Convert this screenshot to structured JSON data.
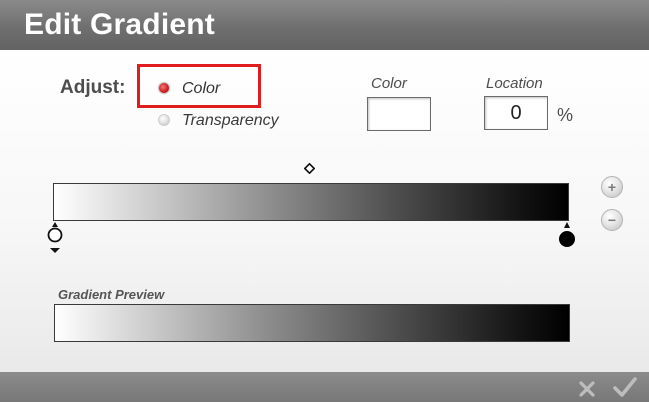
{
  "dialog": {
    "title": "Edit Gradient"
  },
  "adjust": {
    "label": "Adjust:",
    "options": [
      {
        "label": "Color",
        "selected": true
      },
      {
        "label": "Transparency",
        "selected": false
      }
    ]
  },
  "fields": {
    "color_label": "Color",
    "color_value": "#ffffff",
    "location_label": "Location",
    "location_value": "0",
    "location_unit": "%"
  },
  "gradient": {
    "stops": [
      {
        "position_percent": 0,
        "color": "#ffffff"
      },
      {
        "position_percent": 100,
        "color": "#000000"
      }
    ],
    "midpoint_percent": 50,
    "add_button": "+",
    "remove_button": "−"
  },
  "preview": {
    "label": "Gradient Preview"
  },
  "colors": {
    "titlebar": "#6f6f6f",
    "highlight": "#e01c1c",
    "radio_selected": "#d01818"
  },
  "icons": {
    "cancel": "x-icon",
    "confirm": "checkmark-icon",
    "midpoint": "diamond-icon"
  }
}
